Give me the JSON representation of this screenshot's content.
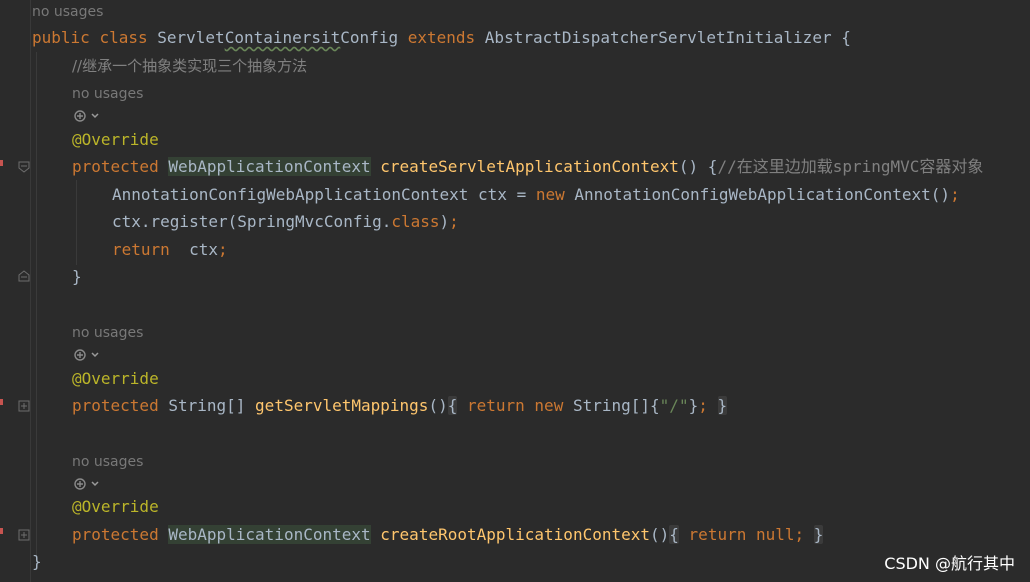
{
  "editor": {
    "usage_hint": "no usages",
    "line_class_decl": {
      "kw_public": "public",
      "kw_class": "class",
      "class_name_a": "Servlet",
      "class_name_b": "Containersit",
      "class_name_c": "Config",
      "kw_extends": "extends",
      "super_class": "AbstractDispatcherServletInitializer",
      "brace": " {"
    },
    "comment_line": "//继承一个抽象类实现三个抽象方法",
    "override": "@Override",
    "method1": {
      "kw_protected": "protected",
      "return_type": "WebApplicationContext",
      "name": "createServletApplicationContext",
      "parens": "() {",
      "comment": "//在这里边加载springMVC容器对象",
      "body_line1_a": "AnnotationConfigWebApplicationContext ctx = ",
      "body_line1_new": "new",
      "body_line1_b": " AnnotationConfigWebApplicationContext()",
      "body_line1_semi": ";",
      "body_line2_a": "ctx.register(SpringMvcConfig.",
      "body_line2_class": "class",
      "body_line2_b": ")",
      "body_line2_semi": ";",
      "body_line3_return": "return",
      "body_line3_b": "  ctx",
      "body_line3_semi": ";",
      "close": "}"
    },
    "method2": {
      "kw_protected": "protected",
      "return_type": "String[]",
      "name": "getServletMappings",
      "parens": "()",
      "open": "{",
      "kw_return": "return",
      "kw_new": "new",
      "array": "String[]{",
      "str": "\"/\"",
      "array_close": "}",
      "semi": ";",
      "close": "}"
    },
    "method3": {
      "kw_protected": "protected",
      "return_type": "WebApplicationContext",
      "name": "createRootApplicationContext",
      "parens": "()",
      "open": "{",
      "kw_return": "return",
      "kw_null": "null",
      "semi": ";",
      "close": "}"
    },
    "class_close": "}"
  },
  "watermark": "CSDN @航行其中",
  "icons": [
    "spring-bean-icon",
    "chevron-down-icon",
    "override-gutter-icon",
    "fold-icon"
  ]
}
